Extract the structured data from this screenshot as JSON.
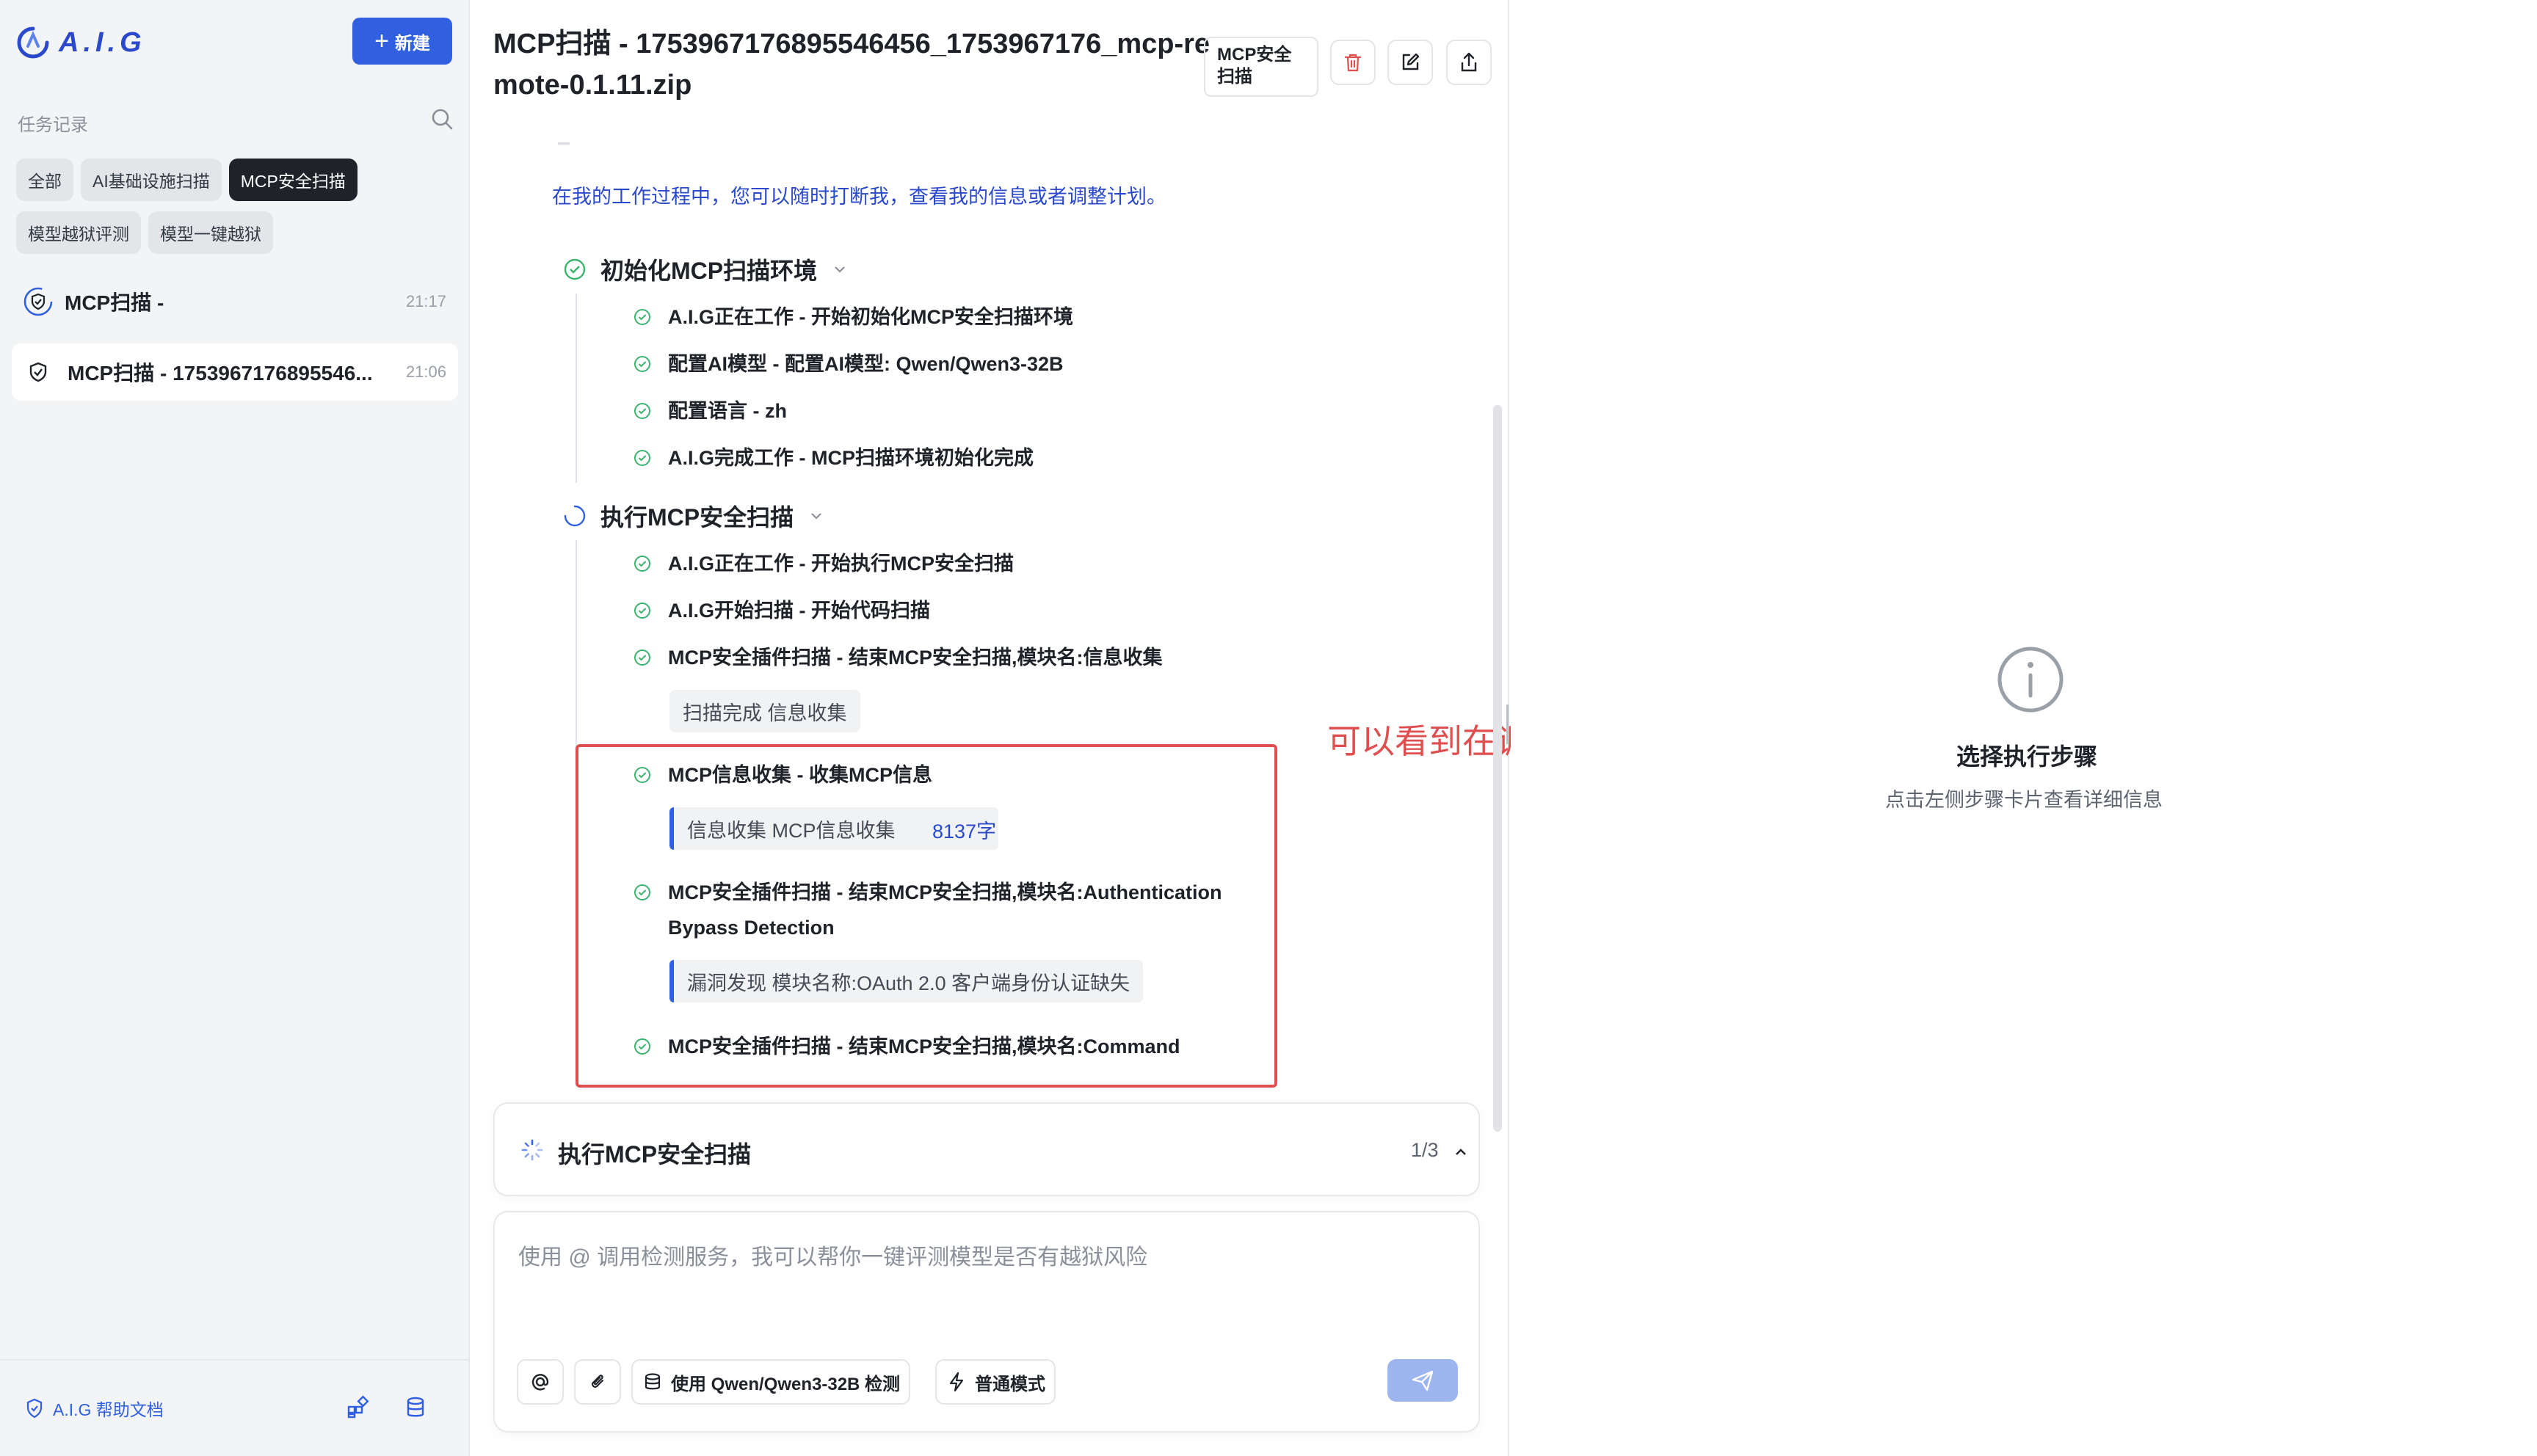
{
  "sidebar": {
    "brand": "A.I.G",
    "new_button": "新建",
    "section_label": "任务记录",
    "filters": [
      "全部",
      "AI基础设施扫描",
      "MCP安全扫描",
      "模型越狱评测",
      "模型一键越狱"
    ],
    "active_filter": "MCP安全扫描",
    "tasks": [
      {
        "name": "MCP扫描 -",
        "time": "21:17"
      },
      {
        "name": "MCP扫描 - 1753967176895546...",
        "time": "21:06"
      }
    ],
    "help_label": "A.I.G 帮助文档"
  },
  "main": {
    "title": "MCP扫描 - 1753967176895546456_1753967176_mcp-remote-0.1.11.zip",
    "badge": "MCP安全扫描",
    "intro": "在我的工作过程中，您可以随时打断我，查看我的信息或者调整计划。",
    "stages": [
      {
        "label": "初始化MCP扫描环境",
        "steps": [
          "A.I.G正在工作 - 开始初始化MCP安全扫描环境",
          "配置AI模型 - 配置AI模型: Qwen/Qwen3-32B",
          "配置语言 - zh",
          "A.I.G完成工作 - MCP扫描环境初始化完成"
        ]
      },
      {
        "label": "执行MCP安全扫描",
        "steps": [
          "A.I.G正在工作 - 开始执行MCP安全扫描",
          "A.I.G开始扫描 - 开始代码扫描",
          "MCP安全插件扫描 - 结束MCP安全扫描,模块名:信息收集",
          "MCP信息收集 - 收集MCP信息",
          "MCP安全插件扫描 - 结束MCP安全扫描,模块名:Authentication Bypass Detection",
          "MCP安全插件扫描 - 结束MCP安全扫描,模块名:Command"
        ],
        "subtags": {
          "scan_done": "扫描完成 信息收集",
          "info_collect": "信息收集 MCP信息收集",
          "info_count": "8137字",
          "vuln": "漏洞发现 模块名称:OAuth 2.0 客户端身份认证缺失"
        }
      }
    ],
    "annotation": "可以看到在调用各种插件开始，等待完成",
    "progress": {
      "label": "执行MCP安全扫描",
      "count": "1/3"
    },
    "input": {
      "placeholder": "使用 @ 调用检测服务，我可以帮你一键评测模型是否有越狱风险",
      "model_label": "使用 Qwen/Qwen3-32B 检测",
      "mode_label": "普通模式"
    }
  },
  "right_panel": {
    "title": "选择执行步骤",
    "subtitle": "点击左侧步骤卡片查看详细信息"
  },
  "colors": {
    "accent": "#3060e0",
    "success": "#3bb46e",
    "annotation": "#e04f4f",
    "sidebar_bg": "#f3f4f6"
  },
  "icons": [
    "aig-logo-icon",
    "plus-icon",
    "search-icon",
    "shield-icon",
    "help-shield-icon",
    "grid-icon",
    "database-icon",
    "trash-icon",
    "edit-icon",
    "share-icon",
    "check-circle-icon",
    "loading-icon",
    "chevron-down-icon",
    "chevron-up-icon",
    "spinner-icon",
    "at-icon",
    "paperclip-icon",
    "bolt-icon",
    "send-icon",
    "info-icon"
  ]
}
